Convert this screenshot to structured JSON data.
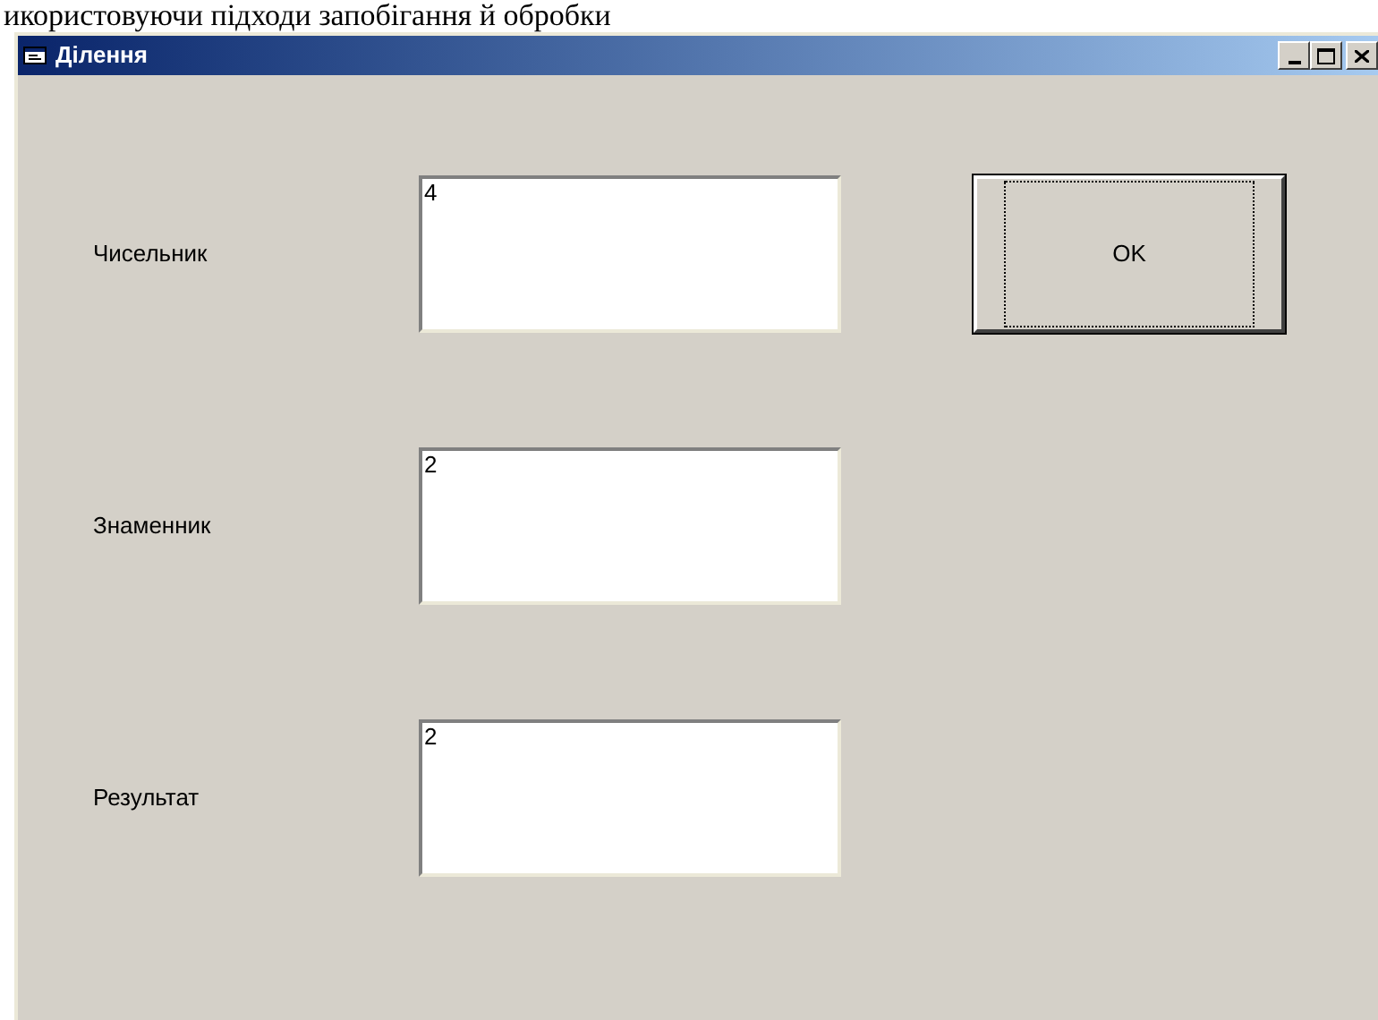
{
  "document_text": "икористовуючи підходи запобігання й обробки",
  "window": {
    "title": "Ділення"
  },
  "fields": [
    {
      "label": "Чисельник",
      "value": "4"
    },
    {
      "label": "Знаменник",
      "value": "2"
    },
    {
      "label": "Результат",
      "value": "2"
    }
  ],
  "button": {
    "label": "OK",
    "focused": true
  }
}
